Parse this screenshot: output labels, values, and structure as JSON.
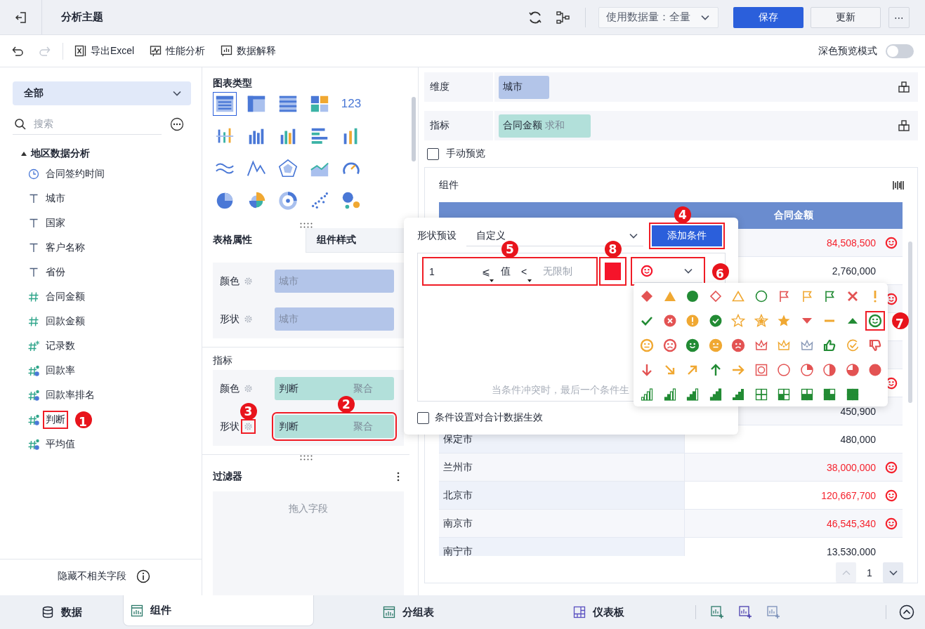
{
  "header": {
    "title": "分析主题",
    "data_volume": "使用数据量：全量",
    "save": "保存",
    "update": "更新",
    "more": "⋯"
  },
  "toolbar": {
    "redo_disabled": true,
    "items": [
      {
        "kind": "excel",
        "label": "导出Excel"
      },
      {
        "kind": "performance",
        "label": "性能分析"
      },
      {
        "kind": "explain",
        "label": "数据解释"
      }
    ],
    "dark_preview": {
      "label": "深色预览模式",
      "on": false
    }
  },
  "fields_panel": {
    "scope": "全部",
    "search_placeholder": "搜索",
    "tree": [
      {
        "label": "地区数据分析",
        "expanded": true,
        "children": [
          {
            "kind": "date",
            "label": "合同签约时间"
          },
          {
            "kind": "text",
            "label": "城市"
          },
          {
            "kind": "text",
            "label": "国家"
          },
          {
            "kind": "text",
            "label": "客户名称"
          },
          {
            "kind": "text",
            "label": "省份"
          },
          {
            "kind": "number",
            "label": "合同金额"
          },
          {
            "kind": "number",
            "label": "回款金额"
          },
          {
            "kind": "count",
            "label": "记录数"
          },
          {
            "kind": "calc",
            "label": "回款率"
          },
          {
            "kind": "calc",
            "label": "回款率排名"
          },
          {
            "kind": "calc",
            "label": "判断",
            "annotation": "1"
          },
          {
            "kind": "calc",
            "label": "平均值"
          }
        ]
      }
    ],
    "hide_irrelevant": "隐藏不相关字段"
  },
  "chart_types": {
    "title": "图表类型",
    "items": [
      {
        "kind": "table",
        "selected": true
      },
      {
        "kind": "cross-table",
        "selected": false
      },
      {
        "kind": "detail-table",
        "selected": false
      },
      {
        "kind": "blocks",
        "selected": false
      },
      {
        "kind": "number",
        "label": "123",
        "selected": false
      },
      {
        "kind": "dot-bar",
        "selected": false
      },
      {
        "kind": "bar",
        "selected": false
      },
      {
        "kind": "color-bar",
        "selected": false
      },
      {
        "kind": "hbar",
        "selected": false
      },
      {
        "kind": "mix-bar",
        "selected": false
      },
      {
        "kind": "wave",
        "selected": false
      },
      {
        "kind": "line",
        "selected": false
      },
      {
        "kind": "radar",
        "selected": false
      },
      {
        "kind": "area",
        "selected": false
      },
      {
        "kind": "gauge",
        "selected": false
      },
      {
        "kind": "pie",
        "selected": false
      },
      {
        "kind": "rose",
        "selected": false
      },
      {
        "kind": "ring",
        "selected": false
      },
      {
        "kind": "scatter",
        "selected": false
      },
      {
        "kind": "bubble",
        "selected": false
      }
    ]
  },
  "properties": {
    "tabs": [
      {
        "label": "表格属性",
        "selected": true
      },
      {
        "label": "组件样式",
        "selected": false
      }
    ],
    "dimension_rows": [
      {
        "label": "颜色",
        "field": "城市"
      },
      {
        "label": "形状",
        "field": "城市"
      }
    ],
    "metric_title": "指标",
    "metric_rows": [
      {
        "label": "颜色",
        "field": "判断",
        "aggregation": "聚合"
      },
      {
        "label": "形状",
        "field": "判断",
        "aggregation": "聚合",
        "annotation": "2",
        "gear_annotation": "3"
      }
    ]
  },
  "filter": {
    "title": "过滤器",
    "drop_hint": "拖入字段"
  },
  "dimension": {
    "label": "维度",
    "chips": [
      {
        "label": "城市"
      }
    ]
  },
  "metric": {
    "label": "指标",
    "chips": [
      {
        "label": "合同金额",
        "aggregation": "求和"
      }
    ]
  },
  "manual_preview": {
    "label": "手动预览",
    "checked": false
  },
  "component": {
    "title": "组件",
    "column_2": "合同金额",
    "rows": [
      {
        "value": "84,508,500",
        "flagged": true
      },
      {
        "value": "2,760,000",
        "flagged": false
      },
      {
        "flagged": true
      },
      {
        "flagged": false
      },
      {
        "flagged": false
      },
      {
        "flagged": true
      },
      {
        "value": "450,900",
        "flagged": false
      },
      {
        "city": "保定市",
        "value": "480,000",
        "flagged": false
      },
      {
        "city": "兰州市",
        "value": "38,000,000",
        "flagged": true
      },
      {
        "city": "北京市",
        "value": "120,667,700",
        "flagged": true
      },
      {
        "city": "南京市",
        "value": "46,545,340",
        "flagged": true
      },
      {
        "city": "南宁市",
        "value": "13,530,000",
        "flagged": false
      }
    ],
    "page": "1"
  },
  "popup": {
    "preset_label": "形状预设",
    "preset_value": "自定义",
    "add_button": {
      "label": "添加条件",
      "annotation": "4"
    },
    "condition": {
      "min": "1",
      "op1": "⩽",
      "value_label": "值",
      "op2": "<",
      "max_placeholder": "无限制",
      "range_annotation": "5",
      "color": "#f5142a",
      "color_annotation": "8",
      "shape_annotation": "6"
    },
    "hint": "当条件冲突时，最后一个条件生",
    "total_checkbox": {
      "label": "条件设置对合计数据生效",
      "checked": false
    },
    "palette": [
      {
        "kind": "diamond",
        "color": "#e35353"
      },
      {
        "kind": "triangle",
        "color": "#f0a832"
      },
      {
        "kind": "circle",
        "color": "#228b34"
      },
      {
        "kind": "diamond-outline",
        "color": "#e35353"
      },
      {
        "kind": "triangle-outline",
        "color": "#f0a832"
      },
      {
        "kind": "circle-outline",
        "color": "#228b34"
      },
      {
        "kind": "flag",
        "color": "#e35353"
      },
      {
        "kind": "flag",
        "color": "#f0a832"
      },
      {
        "kind": "flag",
        "color": "#228b34"
      },
      {
        "kind": "cross",
        "color": "#e35353"
      },
      {
        "kind": "exclaim",
        "color": "#f0a832"
      },
      {
        "kind": "check",
        "color": "#228b34"
      },
      {
        "kind": "cross-circle",
        "color": "#e35353"
      },
      {
        "kind": "exclaim-circle",
        "color": "#f0a832"
      },
      {
        "kind": "check-circle",
        "color": "#228b34"
      },
      {
        "kind": "star-outline",
        "color": "#f0a832"
      },
      {
        "kind": "star-half",
        "color": "#f0a832"
      },
      {
        "kind": "star",
        "color": "#f0a832"
      },
      {
        "kind": "triangle-down",
        "color": "#e35353"
      },
      {
        "kind": "dash",
        "color": "#f0a832"
      },
      {
        "kind": "triangle-up",
        "color": "#228b34"
      },
      {
        "kind": "smile-outline",
        "color": "#228b34",
        "annotation": "7"
      },
      {
        "kind": "neutral-outline",
        "color": "#f0a832"
      },
      {
        "kind": "sad-outline",
        "color": "#e35353"
      },
      {
        "kind": "smile-filled",
        "color": "#228b34"
      },
      {
        "kind": "neutral-filled",
        "color": "#f0a832"
      },
      {
        "kind": "sad-filled",
        "color": "#e35353"
      },
      {
        "kind": "crown",
        "color": "#e35353"
      },
      {
        "kind": "crown",
        "color": "#f0a832"
      },
      {
        "kind": "crown",
        "color": "#8a9ab8"
      },
      {
        "kind": "thumb-up",
        "color": "#228b34"
      },
      {
        "kind": "check-partial",
        "color": "#f0a832"
      },
      {
        "kind": "thumb-down",
        "color": "#e35353"
      },
      {
        "kind": "arrow-down",
        "color": "#e35353"
      },
      {
        "kind": "arrow-down-right",
        "color": "#f0a832"
      },
      {
        "kind": "arrow-up-right",
        "color": "#f0a832"
      },
      {
        "kind": "arrow-up",
        "color": "#228b34"
      },
      {
        "kind": "arrow-right",
        "color": "#f0a832"
      },
      {
        "kind": "target-square",
        "color": "#e35353"
      },
      {
        "kind": "pie-empty",
        "color": "#e35353"
      },
      {
        "kind": "pie-quarter",
        "color": "#e35353"
      },
      {
        "kind": "pie-half",
        "color": "#e35353"
      },
      {
        "kind": "pie-three-quarter",
        "color": "#e35353"
      },
      {
        "kind": "pie-full",
        "color": "#e35353"
      },
      {
        "kind": "bars-outline",
        "color": "#228b34"
      },
      {
        "kind": "bars-one",
        "color": "#228b34"
      },
      {
        "kind": "bars-two",
        "color": "#228b34"
      },
      {
        "kind": "bars-three",
        "color": "#228b34"
      },
      {
        "kind": "bars-full",
        "color": "#228b34"
      },
      {
        "kind": "quad-empty",
        "color": "#228b34"
      },
      {
        "kind": "quad-one",
        "color": "#228b34"
      },
      {
        "kind": "quad-two",
        "color": "#228b34"
      },
      {
        "kind": "quad-three",
        "color": "#228b34"
      },
      {
        "kind": "quad-full",
        "color": "#228b34"
      }
    ]
  },
  "bottom_tabs": [
    {
      "kind": "data",
      "label": "数据",
      "selected": false
    },
    {
      "kind": "component",
      "label": "组件",
      "selected": true
    },
    {
      "kind": "group-table",
      "label": "分组表",
      "selected": false
    },
    {
      "kind": "dashboard",
      "label": "仪表板",
      "selected": false
    }
  ]
}
